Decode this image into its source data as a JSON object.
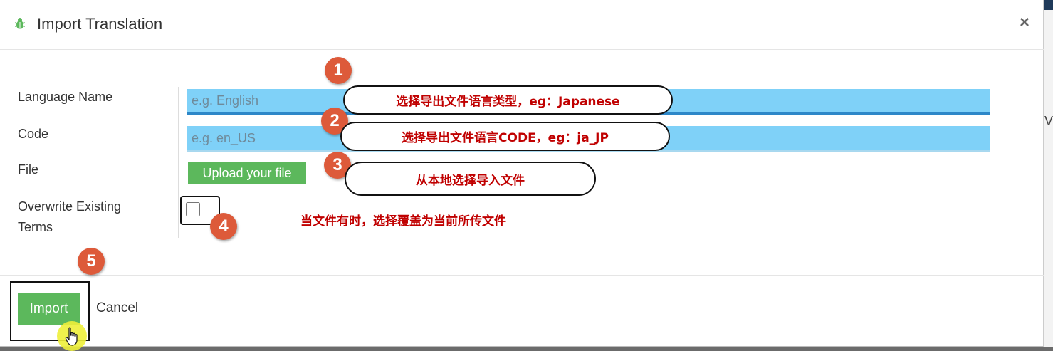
{
  "modal": {
    "title": "Import Translation",
    "close_label": "×"
  },
  "form": {
    "language_name": {
      "label": "Language Name",
      "placeholder": "e.g. English"
    },
    "code": {
      "label": "Code",
      "placeholder": "e.g. en_US"
    },
    "file": {
      "label": "File",
      "button_label": "Upload your file"
    },
    "overwrite": {
      "label_line1": "Overwrite Existing",
      "label_line2": "Terms",
      "checked": false
    }
  },
  "footer": {
    "import_label": "Import",
    "cancel_label": "Cancel"
  },
  "annotations": {
    "step1": {
      "number": "1",
      "text": "选择导出文件语言类型，eg：Japanese"
    },
    "step2": {
      "number": "2",
      "text": "选择导出文件语言CODE，eg：ja_JP"
    },
    "step3": {
      "number": "3",
      "text": "从本地选择导入文件"
    },
    "step4": {
      "number": "4",
      "text": "当文件有时，选择覆盖为当前所传文件"
    },
    "step5": {
      "number": "5"
    }
  },
  "background": {
    "letter": "V"
  },
  "colors": {
    "accent_green": "#5cb85c",
    "input_highlight": "#7fd1f8",
    "annotation_red": "#c00000",
    "badge_orange": "#dd5a3a"
  }
}
